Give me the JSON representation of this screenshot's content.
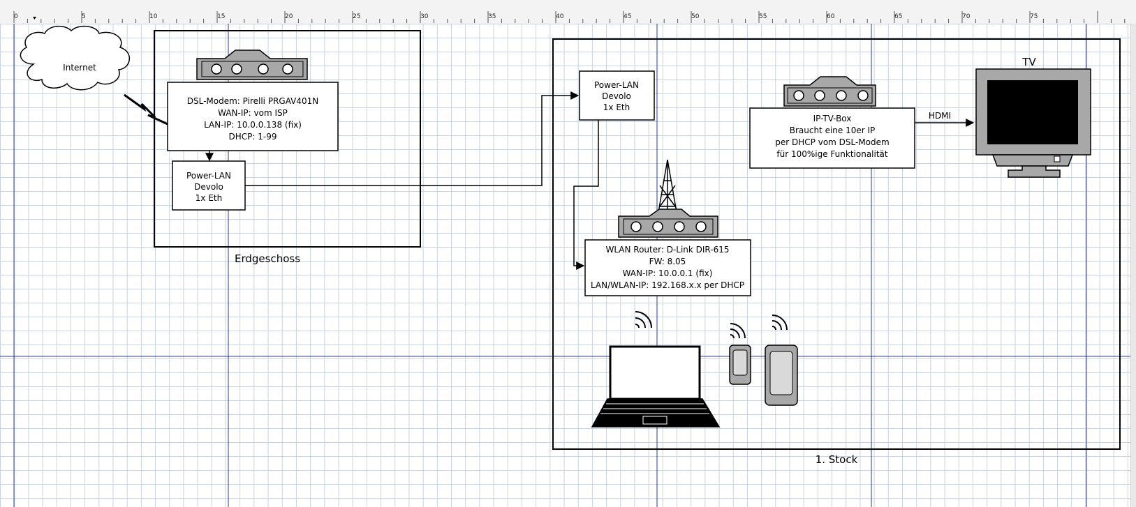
{
  "ruler": {
    "labels": [
      "0",
      "5",
      "10",
      "15",
      "20",
      "25",
      "30",
      "35",
      "40",
      "45",
      "50",
      "55",
      "60",
      "65",
      "70",
      "75"
    ]
  },
  "diagram": {
    "cloud": {
      "label": "Internet"
    },
    "floor_ground": {
      "label": "Erdgeschoss"
    },
    "floor_first": {
      "label": "1. Stock"
    },
    "modem": {
      "lines": [
        "DSL-Modem: Pirelli PRGAV401N",
        "WAN-IP: vom ISP",
        "LAN-IP: 10.0.0.138 (fix)",
        "DHCP: 1-99"
      ]
    },
    "powerlan_left": {
      "lines": [
        "Power-LAN",
        "Devolo",
        "1x Eth"
      ]
    },
    "powerlan_right": {
      "lines": [
        "Power-LAN",
        "Devolo",
        "1x Eth"
      ]
    },
    "iptv": {
      "lines": [
        "IP-TV-Box",
        "Braucht eine 10er IP",
        "per DHCP vom DSL-Modem",
        "für 100%ige Funktionalität"
      ]
    },
    "router": {
      "lines": [
        "WLAN Router: D-Link DIR-615",
        "FW: 8.05",
        "WAN-IP: 10.0.0.1 (fix)",
        "LAN/WLAN-IP: 192.168.x.x per DHCP"
      ]
    },
    "tv": {
      "label": "TV"
    },
    "hdmi": {
      "label": "HDMI"
    }
  },
  "colors": {
    "grid": "#c9d2de",
    "guide": "#2b3990",
    "device_gray": "#a8a8a8"
  }
}
